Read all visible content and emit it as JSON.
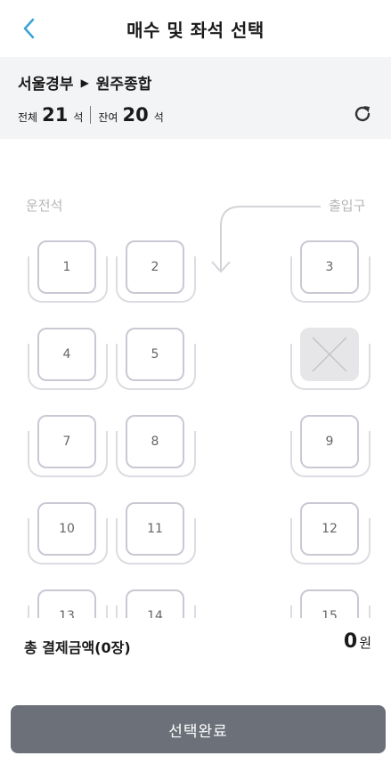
{
  "header": {
    "title": "매수 및 좌석 선택"
  },
  "route": {
    "origin": "서울경부",
    "destination": "원주종합"
  },
  "counts": {
    "total_label": "전체",
    "total": "21",
    "unit": "석",
    "remaining_label": "잔여",
    "remaining": "20"
  },
  "layout": {
    "driver_label": "운전석",
    "entrance_label": "출입구"
  },
  "seats": [
    {
      "number": "1"
    },
    {
      "number": "2"
    },
    {
      "number": "3"
    },
    {
      "number": "4"
    },
    {
      "number": "5"
    },
    {
      "number": ""
    },
    {
      "number": "7"
    },
    {
      "number": "8"
    },
    {
      "number": "9"
    },
    {
      "number": "10"
    },
    {
      "number": "11"
    },
    {
      "number": "12"
    },
    {
      "number": "13"
    },
    {
      "number": "14"
    },
    {
      "number": "15"
    }
  ],
  "summary": {
    "label": "총 결제금액(0장)",
    "amount": "0",
    "currency": "원"
  },
  "cta": {
    "label": "선택완료"
  },
  "colors": {
    "accent": "#3aa3d4",
    "button": "#6b7079",
    "panel": "#f3f4f6"
  }
}
